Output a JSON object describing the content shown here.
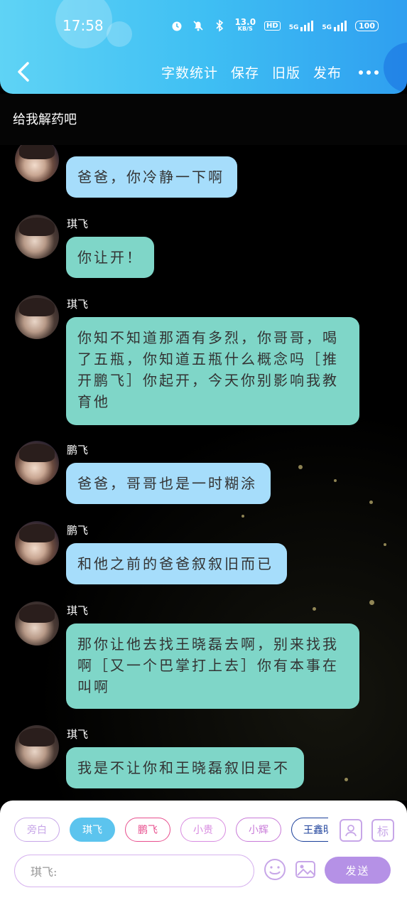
{
  "status_bar": {
    "time": "17:58",
    "net_speed_value": "13.0",
    "net_speed_unit": "KB/S",
    "hd": "HD",
    "signal1": "5G",
    "signal2": "5G",
    "battery": "100"
  },
  "toolbar": {
    "word_count": "字数统计",
    "save": "保存",
    "old_version": "旧版",
    "publish": "发布"
  },
  "page_title": "给我解药吧",
  "messages": [
    {
      "sender": "",
      "text": "爸爸，你冷静一下啊"
    },
    {
      "sender": "琪飞",
      "text": "你让开！"
    },
    {
      "sender": "琪飞",
      "text": "你知不知道那酒有多烈，你哥哥，喝了五瓶，你知道五瓶什么概念吗［推开鹏飞］你起开，今天你别影响我教育他"
    },
    {
      "sender": "鹏飞",
      "text": "爸爸，哥哥也是一时糊涂"
    },
    {
      "sender": "鹏飞",
      "text": "和他之前的爸爸叙叙旧而已"
    },
    {
      "sender": "琪飞",
      "text": "那你让他去找王晓磊去啊，别来找我啊［又一个巴掌打上去］你有本事在叫啊"
    },
    {
      "sender": "琪飞",
      "text": "我是不让你和王晓磊叙旧是不"
    }
  ],
  "chips": [
    "旁白",
    "琪飞",
    "鹏飞",
    "小贵",
    "小辉",
    "王鑫明"
  ],
  "chip_icons": {
    "tag": "标"
  },
  "input": {
    "placeholder": "琪飞:"
  },
  "send_label": "发送",
  "colors": {
    "header_start": "#5fd3f5",
    "header_end": "#2f9ff0",
    "bubble_blue": "#a6ddfb",
    "bubble_teal": "#7fd6c8",
    "send": "#b591e6"
  }
}
